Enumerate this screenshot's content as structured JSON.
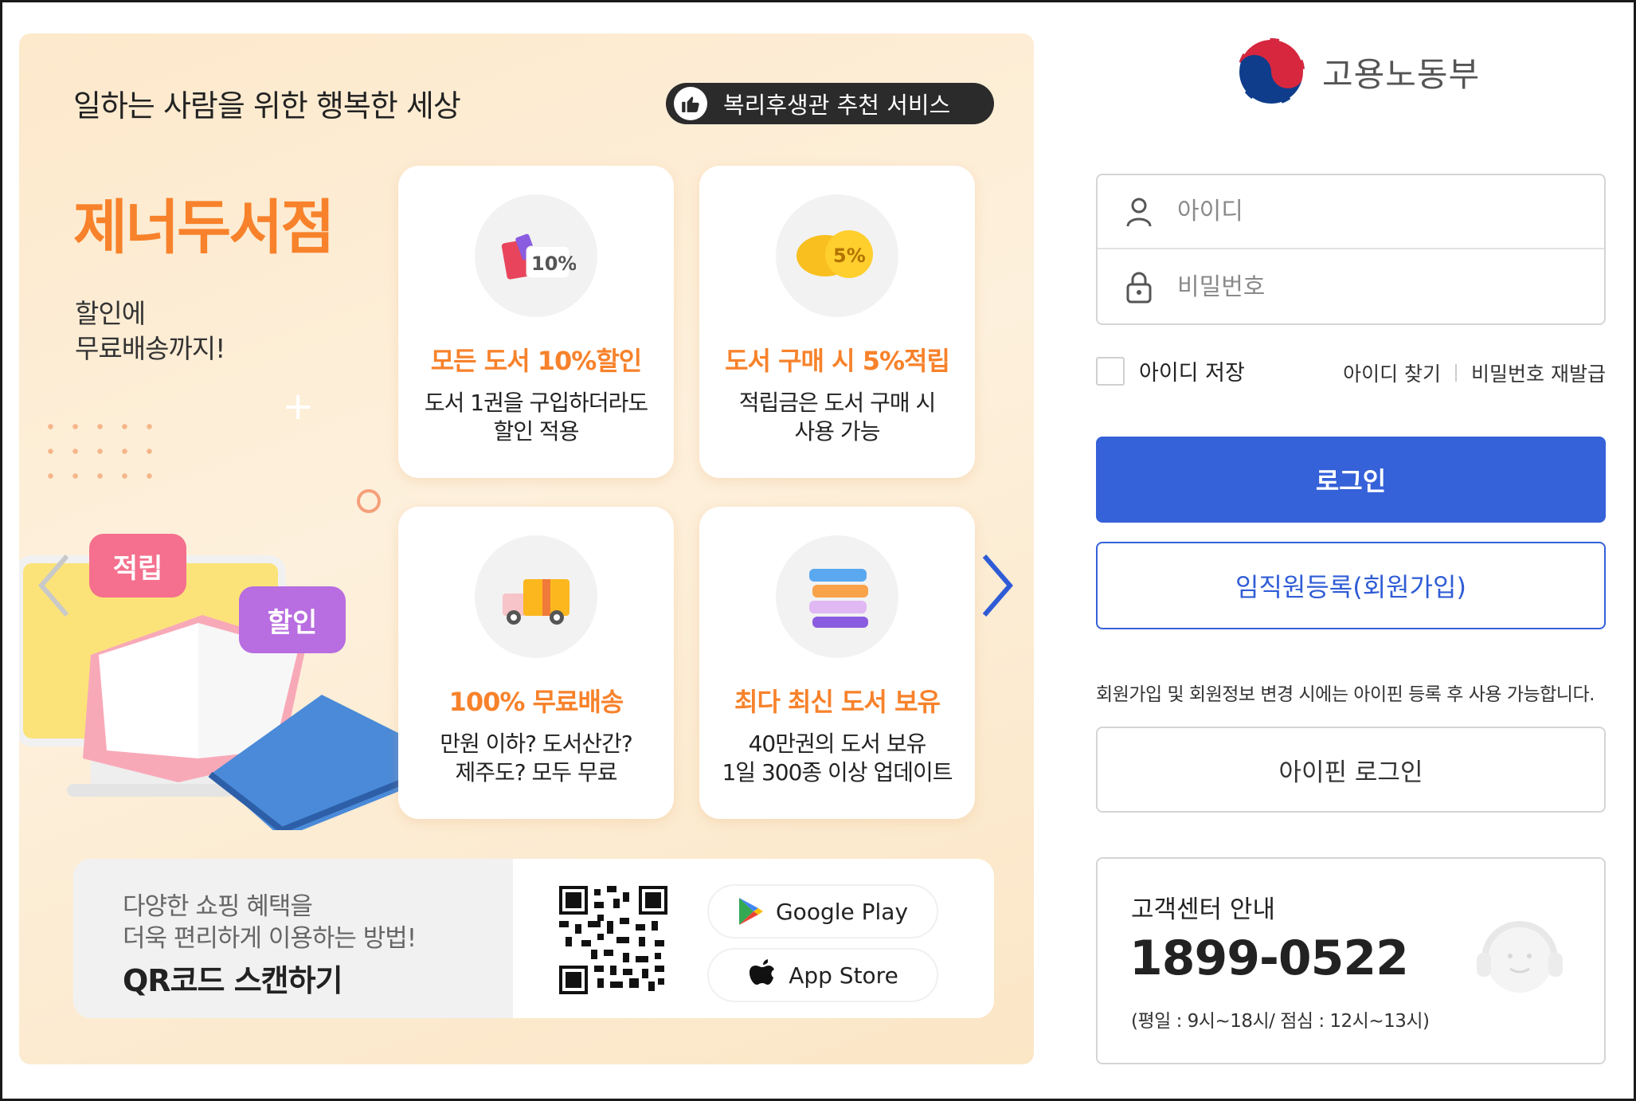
{
  "banner": {
    "headline": "일하는 사람을 위한 행복한 세상",
    "badge": "복리후생관 추천 서비스",
    "brand": "제너두서점",
    "sub_line1": "할인에",
    "sub_line2": "무료배송까지!",
    "tag_earn": "적립",
    "tag_discount": "할인",
    "cards": [
      {
        "title": "모든 도서 10%할인",
        "desc1": "도서 1권을 구입하더라도",
        "desc2": "할인 적용",
        "icon_text": "10%"
      },
      {
        "title": "도서 구매 시 5%적립",
        "desc1": "적립금은 도서 구매 시",
        "desc2": "사용 가능",
        "icon_text": "5%"
      },
      {
        "title": "100% 무료배송",
        "desc1": "만원 이하? 도서산간?",
        "desc2": "제주도? 모두 무료"
      },
      {
        "title": "최다 최신 도서 보유",
        "desc1": "40만권의 도서 보유",
        "desc2": "1일 300종 이상 업데이트"
      }
    ],
    "qr": {
      "line1": "다양한 쇼핑 혜택을",
      "line2": "더욱 편리하게 이용하는 방법!",
      "line3": "QR코드 스캔하기",
      "google_play": "Google Play",
      "app_store": "App Store"
    },
    "colors": {
      "accent_orange": "#f7822b",
      "tag_pink": "#f4708e",
      "tag_purple": "#b86de0",
      "nav_arrow": "#2f5cd6"
    }
  },
  "login": {
    "org_name": "고용노동부",
    "id_placeholder": "아이디",
    "pw_placeholder": "비밀번호",
    "remember_label": "아이디 저장",
    "find_id": "아이디 찾기",
    "reset_pw": "비밀번호 재발급",
    "login_button": "로그인",
    "register_button": "임직원등록(회원가입)",
    "notice": "회원가입 및 회원정보 변경 시에는 아이핀 등록 후 사용 가능합니다.",
    "ipin_button": "아이핀 로그인",
    "colors": {
      "primary": "#3561d9"
    }
  },
  "support": {
    "title": "고객센터 안내",
    "phone": "1899-0522",
    "hours": "(평일 : 9시~18시/ 점심 : 12시~13시)"
  },
  "icons": [
    "thumbs-up-icon",
    "user-icon",
    "lock-icon",
    "chevron-left-icon",
    "chevron-right-icon",
    "google-play-icon",
    "apple-icon",
    "headset-icon",
    "taegeuk-logo-icon"
  ]
}
